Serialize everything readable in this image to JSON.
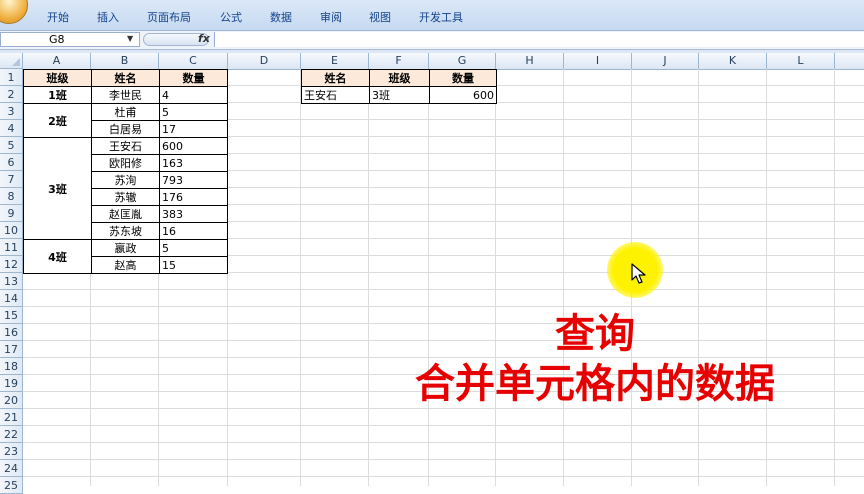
{
  "ribbon": {
    "tabs": [
      "开始",
      "插入",
      "页面布局",
      "公式",
      "数据",
      "审阅",
      "视图",
      "开发工具"
    ]
  },
  "formula_bar": {
    "name_box": "G8",
    "fx_icon": "fx",
    "formula": ""
  },
  "columns": [
    "A",
    "B",
    "C",
    "D",
    "E",
    "F",
    "G",
    "H",
    "I",
    "J",
    "K",
    "L"
  ],
  "rows": [
    "1",
    "2",
    "3",
    "4",
    "5",
    "6",
    "7",
    "8",
    "9",
    "10",
    "11",
    "12",
    "13",
    "14",
    "15",
    "16",
    "17",
    "18",
    "19",
    "20",
    "21",
    "22",
    "23",
    "24",
    "25"
  ],
  "source_table": {
    "headers": [
      "班级",
      "姓名",
      "数量"
    ],
    "groups": [
      {
        "class": "1班",
        "names": [
          "李世民"
        ],
        "qty": [
          "4"
        ]
      },
      {
        "class": "2班",
        "names": [
          "杜甫",
          "白居易"
        ],
        "qty": [
          "5",
          "17"
        ]
      },
      {
        "class": "3班",
        "names": [
          "王安石",
          "欧阳修",
          "苏洵",
          "苏辙",
          "赵匡胤",
          "苏东坡"
        ],
        "qty": [
          "600",
          "163",
          "793",
          "176",
          "383",
          "16"
        ]
      },
      {
        "class": "4班",
        "names": [
          "嬴政",
          "赵高"
        ],
        "qty": [
          "5",
          "15"
        ]
      }
    ]
  },
  "lookup_table": {
    "headers": [
      "姓名",
      "班级",
      "数量"
    ],
    "row": [
      "王安石",
      "3班",
      "600"
    ]
  },
  "overlay": {
    "title": "查询",
    "subtitle": "合并单元格内的数据",
    "color": "#e60000"
  }
}
